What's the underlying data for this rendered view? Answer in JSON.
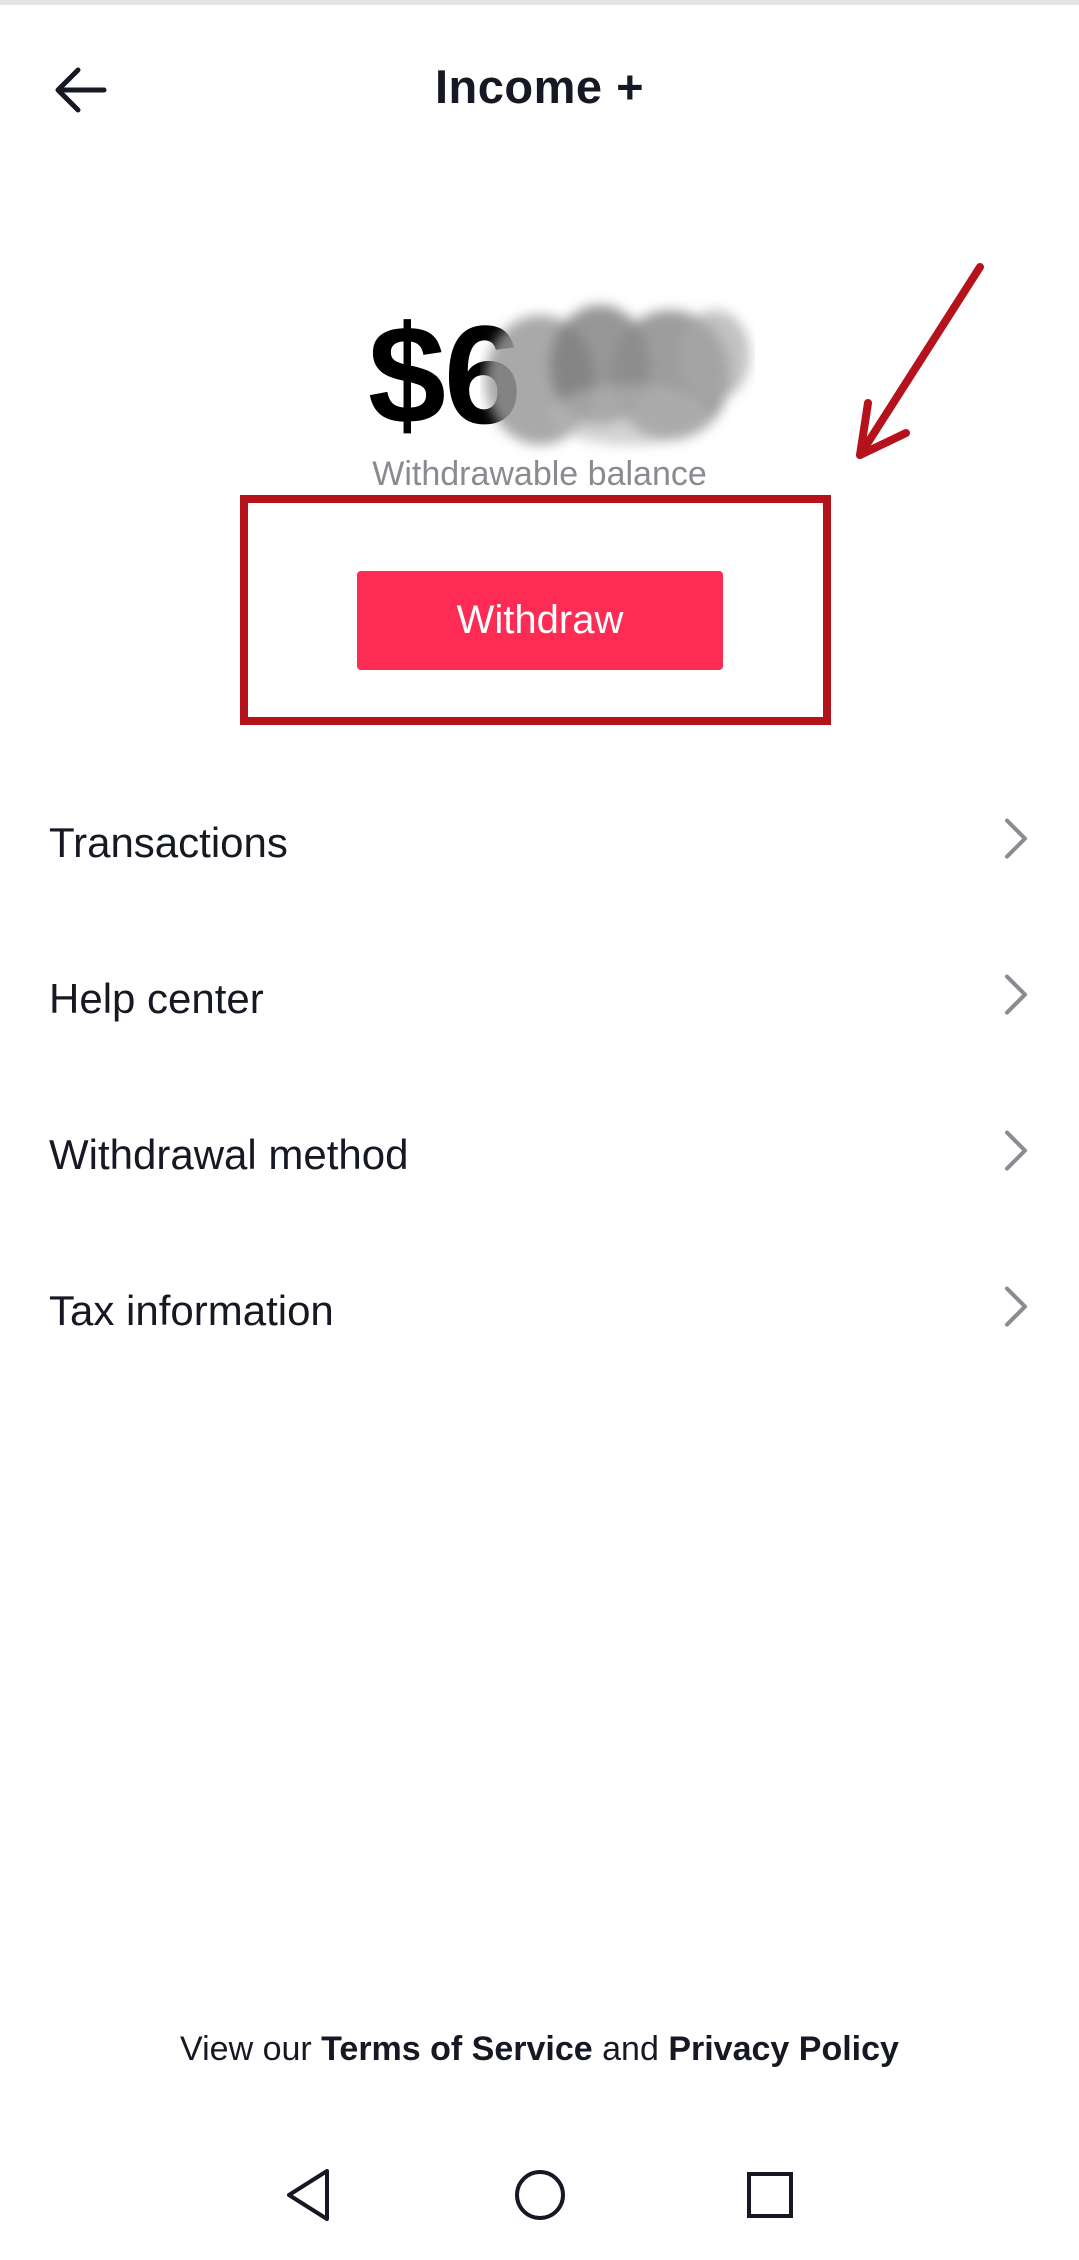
{
  "header": {
    "title": "Income +",
    "back_icon": "arrow-left-icon"
  },
  "balance": {
    "amount_visible": "$6",
    "label": "Withdrawable balance"
  },
  "actions": {
    "withdraw_label": "Withdraw"
  },
  "annotation": {
    "color": "#b5121b"
  },
  "menu": {
    "items": [
      {
        "label": "Transactions",
        "icon": "chevron-right-icon"
      },
      {
        "label": "Help center",
        "icon": "chevron-right-icon"
      },
      {
        "label": "Withdrawal method",
        "icon": "chevron-right-icon"
      },
      {
        "label": "Tax information",
        "icon": "chevron-right-icon"
      }
    ]
  },
  "footer": {
    "prefix": "View our",
    "terms": "Terms of Service",
    "and": "and",
    "privacy": "Privacy Policy"
  },
  "navbar": {
    "back": "triangle-back-icon",
    "home": "circle-home-icon",
    "recents": "square-recents-icon"
  },
  "colors": {
    "accent": "#fe2c55",
    "text": "#161823",
    "muted": "#8a8b91"
  }
}
